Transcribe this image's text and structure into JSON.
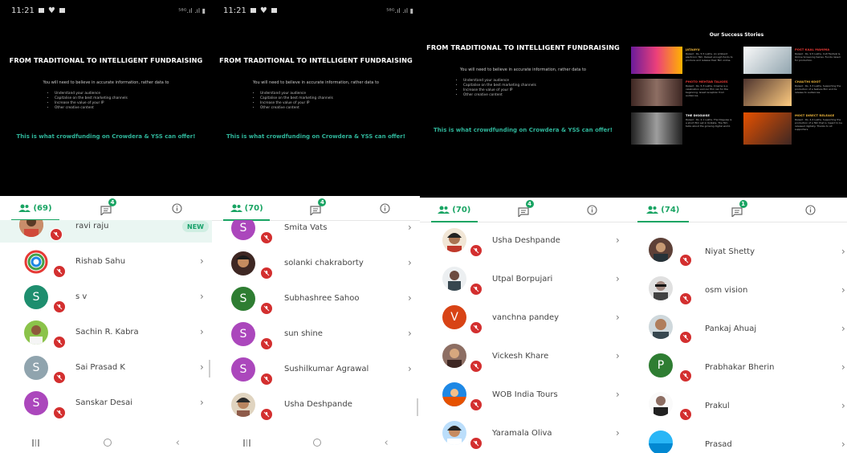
{
  "statusbar": {
    "time": "11:21",
    "signal": "⁵⁸ᴳ.ıl .ıl ▮"
  },
  "slide": {
    "title": "FROM TRADITIONAL TO INTELLIGENT FUNDRAISING",
    "intro": "You will need to believe in accurate information, rather data to",
    "bullets": [
      "Understand your audience",
      "Capitalise on the best marketing channels",
      "Increase the value of your IP",
      "Other creative content"
    ],
    "tagline": "This is what crowdfunding on Crowdera & YSS can offer!"
  },
  "success": {
    "title": "Our Success Stories",
    "stories": [
      {
        "title": "JATAAYU",
        "text": "Raised : Rs. 5.5 Lakhs. An ambient electronic film. Raised enough funds to produce and release their film online."
      },
      {
        "title": "POST KAAL MAHIMA",
        "text": "Raised : Rs. 9.5 Lakhs. Cult Festival & Online Screening Series. Funds raised for production."
      },
      {
        "title": "PHOTO MEHTAB TALKIES",
        "text": "Raised : Rs. 5.3 Lakhs. Cinema is a celebration and our film ran for the beginning. Great reception from audiences."
      },
      {
        "title": "CHAUTHI KOOT",
        "text": "Raised : Rs. 3.3 Lakhs. Supporting the production of a feature film and its release to audiences."
      },
      {
        "title": "THE DISGUISE",
        "text": "Raised : Rs. 2.1 Lakhs. The Disguise is a short film set in Kolkata. The film talks about the growing digital world."
      },
      {
        "title": "MOST DIRECT RELEASE",
        "text": "Raised : Rs. 4.4 Lakhs. Supporting the production of a film that is meant to be released digitally. Thanks to all supporters."
      }
    ]
  },
  "panels": [
    {
      "participants_count": "(69)",
      "chat_badge": "4",
      "rows": [
        {
          "name": "ravi raju",
          "avatar": "photo",
          "badge": "NEW"
        },
        {
          "name": "Rishab Sahu",
          "avatar": "logo"
        },
        {
          "name": "s v",
          "avatar": "S",
          "color": "#1e8e6e"
        },
        {
          "name": "Sachin R. Kabra",
          "avatar": "photo"
        },
        {
          "name": "Sai Prasad K",
          "avatar": "S",
          "color": "#90a4ae"
        },
        {
          "name": "Sanskar Desai",
          "avatar": "S",
          "color": "#ab47bc"
        }
      ]
    },
    {
      "participants_count": "(70)",
      "chat_badge": "4",
      "rows": [
        {
          "name": "Smita Vats",
          "avatar": "S",
          "color": "#ab47bc"
        },
        {
          "name": "solanki chakraborty",
          "avatar": "photo"
        },
        {
          "name": "Subhashree Sahoo",
          "avatar": "S",
          "color": "#2e7d32"
        },
        {
          "name": "sun shine",
          "avatar": "S",
          "color": "#ab47bc"
        },
        {
          "name": "Sushilkumar Agrawal",
          "avatar": "S",
          "color": "#ab47bc"
        },
        {
          "name": "Usha Deshpande",
          "avatar": "photo"
        }
      ]
    },
    {
      "participants_count": "(70)",
      "chat_badge": "4",
      "rows": [
        {
          "name": "Usha Deshpande",
          "avatar": "photo"
        },
        {
          "name": "Utpal Borpujari",
          "avatar": "photo"
        },
        {
          "name": "vanchna pandey",
          "avatar": "V",
          "color": "#d84315"
        },
        {
          "name": "Vickesh Khare",
          "avatar": "photo"
        },
        {
          "name": "WOB India Tours",
          "avatar": "photo"
        },
        {
          "name": "Yaramala Oliva",
          "avatar": "photo"
        }
      ]
    },
    {
      "participants_count": "(74)",
      "chat_badge": "1",
      "rows": [
        {
          "name": "Niyat Shetty",
          "avatar": "photo"
        },
        {
          "name": "osm vision",
          "avatar": "photo"
        },
        {
          "name": "Pankaj Ahuaj",
          "avatar": "photo"
        },
        {
          "name": "Prabhakar Bherin",
          "avatar": "P",
          "color": "#2e7d32"
        },
        {
          "name": "Prakul",
          "avatar": "photo"
        },
        {
          "name": "Prasad",
          "avatar": "photo"
        }
      ]
    }
  ],
  "colors": {
    "accent": "#19a463",
    "mute": "#d32f2f",
    "tagline": "#2fb59a",
    "new_badge_bg": "#cfeee2"
  }
}
